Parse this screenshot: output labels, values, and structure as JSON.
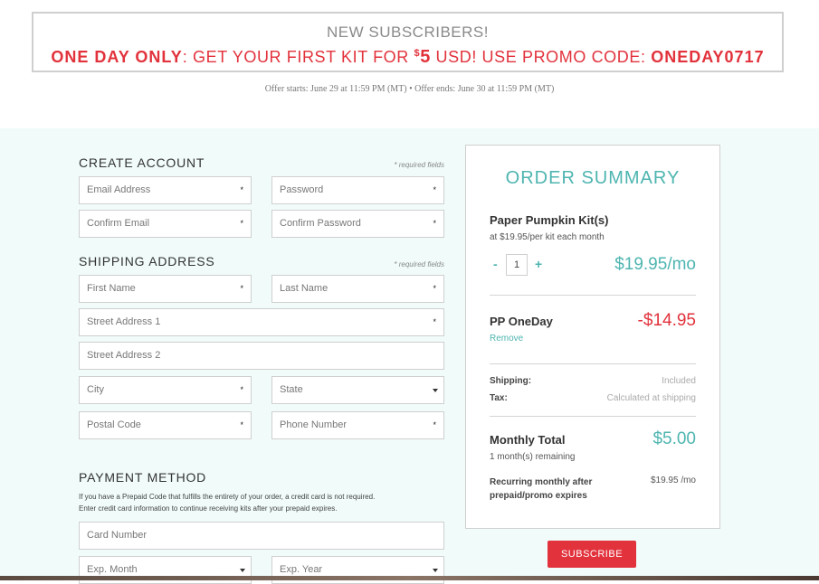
{
  "promo": {
    "heading": "NEW SUBSCRIBERS!",
    "one_day": "ONE DAY ONLY",
    "text_mid": ": GET YOUR FIRST KIT FOR ",
    "currency_symbol": "$",
    "price": "5",
    "text_after": " USD! USE PROMO CODE: ",
    "code": "ONEDAY0717",
    "offer_dates": "Offer starts: June 29 at 11:59 PM (MT) • Offer ends: June 30 at 11:59 PM (MT)"
  },
  "create_account": {
    "title": "CREATE ACCOUNT",
    "required_note": "* required fields",
    "email_placeholder": "Email Address",
    "password_placeholder": "Password",
    "confirm_email_placeholder": "Confirm Email",
    "confirm_password_placeholder": "Confirm Password"
  },
  "shipping": {
    "title": "SHIPPING ADDRESS",
    "required_note": "* required fields",
    "first_name_placeholder": "First Name",
    "last_name_placeholder": "Last Name",
    "street1_placeholder": "Street Address 1",
    "street2_placeholder": "Street Address 2",
    "city_placeholder": "City",
    "state_placeholder": "State",
    "postal_placeholder": "Postal Code",
    "phone_placeholder": "Phone Number"
  },
  "payment": {
    "title": "PAYMENT METHOD",
    "note_line1": "If you have a Prepaid Code that fulfills the entirety of your order, a credit card is not required.",
    "note_line2": "Enter credit card information to continue receiving kits after your prepaid expires.",
    "card_placeholder": "Card Number",
    "exp_month_placeholder": "Exp. Month",
    "exp_year_placeholder": "Exp. Year"
  },
  "required_mark": "*",
  "summary": {
    "title": "ORDER SUMMARY",
    "product_name": "Paper Pumpkin Kit(s)",
    "product_rate": "at $19.95/per kit each month",
    "qty_minus": "-",
    "qty_value": "1",
    "qty_plus": "+",
    "product_price": "$19.95/mo",
    "promo_name": "PP OneDay",
    "promo_remove": "Remove",
    "promo_discount": "-$14.95",
    "shipping_label": "Shipping:",
    "shipping_value": "Included",
    "tax_label": "Tax:",
    "tax_value": "Calculated at shipping",
    "total_label": "Monthly Total",
    "total_remaining": "1 month(s) remaining",
    "total_value": "$5.00",
    "recurring_line1": "Recurring monthly after",
    "recurring_line2": "prepaid/promo expires",
    "recurring_value": "$19.95 /mo"
  },
  "subscribe_label": "SUBSCRIBE",
  "colors": {
    "accent_teal": "#4eb5b0",
    "accent_red": "#e2323c",
    "background_tint": "#f0fbfa"
  }
}
